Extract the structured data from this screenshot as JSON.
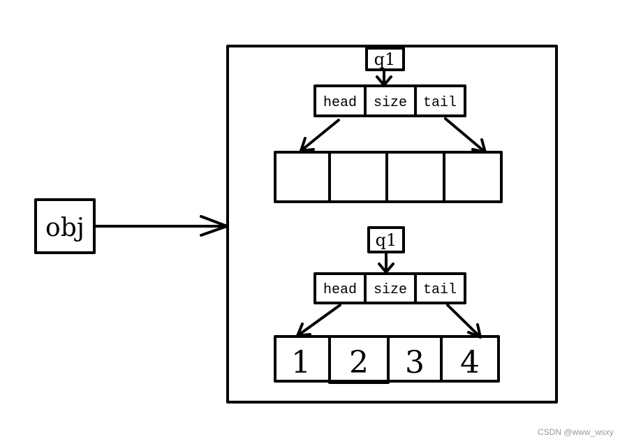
{
  "obj_label": "obj",
  "top_struct": {
    "pointer": "q1",
    "fields": [
      "head",
      "size",
      "tail"
    ],
    "cells": [
      "",
      "",
      "",
      ""
    ]
  },
  "bottom_struct": {
    "pointer": "q1",
    "fields": [
      "head",
      "size",
      "tail"
    ],
    "cells": [
      "1",
      "2",
      "3",
      "4"
    ]
  },
  "watermark": "CSDN @www_wsxy",
  "colors": {
    "stroke": "#000000",
    "watermark": "#999999"
  }
}
